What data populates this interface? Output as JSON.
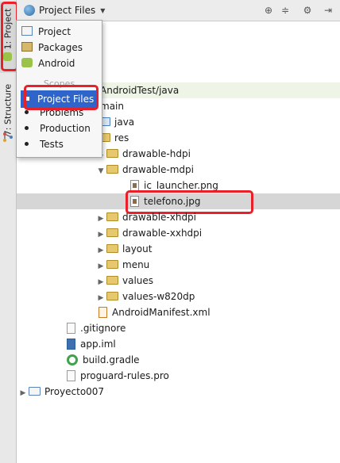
{
  "tool_strip": {
    "project_tab": "1: Project",
    "structure_tab": "7: Structure"
  },
  "toolbar": {
    "view_selector": "Project Files",
    "icons": [
      "sync-icon",
      "collapse-all-icon",
      "gear-icon",
      "hide-icon"
    ]
  },
  "popup": {
    "items": [
      "Project",
      "Packages",
      "Android"
    ],
    "separator": "Scopes",
    "selected": "Project Files",
    "scopes": [
      "Problems",
      "Production",
      "Tests"
    ]
  },
  "tree": {
    "root_path": "AndroidTest/java",
    "main": "main",
    "java": "java",
    "res": "res",
    "drawable_hdpi": "drawable-hdpi",
    "drawable_mdpi": "drawable-mdpi",
    "ic_launcher": "ic_launcher.png",
    "telefono": "telefono.jpg",
    "drawable_xhdpi": "drawable-xhdpi",
    "drawable_xxhdpi": "drawable-xxhdpi",
    "layout": "layout",
    "menu": "menu",
    "values": "values",
    "values_w820dp": "values-w820dp",
    "manifest": "AndroidManifest.xml",
    "gitignore": ".gitignore",
    "app_iml": "app.iml",
    "build_gradle": "build.gradle",
    "proguard": "proguard-rules.pro",
    "project": "Proyecto007"
  },
  "colors": {
    "highlight_red": "#e8202a",
    "selection_blue": "#2f65ca",
    "current_row_gray": "#d6d6d6"
  }
}
